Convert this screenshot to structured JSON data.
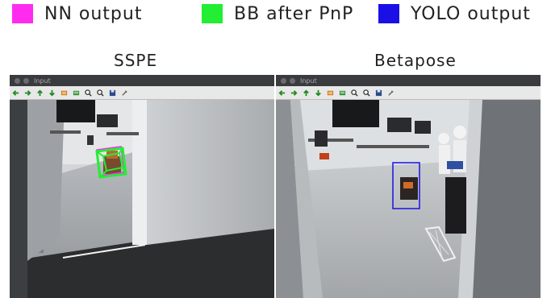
{
  "legend": [
    {
      "label": "NN output",
      "color": "#ff2cf0"
    },
    {
      "label": "BB after PnP",
      "color": "#22ee33"
    },
    {
      "label": "YOLO output",
      "color": "#1a10e6"
    }
  ],
  "panels": [
    {
      "title": "SSPE",
      "window_title": "Input"
    },
    {
      "title": "Betapose",
      "window_title": "Input"
    }
  ],
  "toolbar_icons": [
    "arrow-left-icon",
    "arrow-right-icon",
    "arrow-up-icon",
    "arrow-down-icon",
    "image-icon",
    "image-window-icon",
    "zoom-in-icon",
    "zoom-out-icon",
    "save-icon",
    "settings-icon"
  ]
}
